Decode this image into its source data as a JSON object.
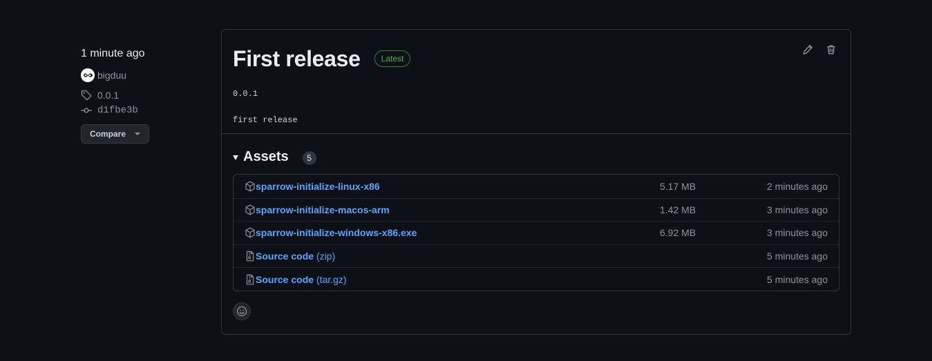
{
  "sidebar": {
    "time": "1 minute ago",
    "author": "bigduu",
    "tag": "0.0.1",
    "commit": "d1fbe3b",
    "compare_label": "Compare"
  },
  "release": {
    "title": "First release",
    "badge": "Latest",
    "tag_line": "0.0.1",
    "body": "first release"
  },
  "assets": {
    "label": "Assets",
    "count": "5",
    "items": [
      {
        "name": "sparrow-initialize-linux-x86",
        "suffix": "",
        "size": "5.17 MB",
        "when": "2 minutes ago",
        "icon": "package-icon"
      },
      {
        "name": "sparrow-initialize-macos-arm",
        "suffix": "",
        "size": "1.42 MB",
        "when": "3 minutes ago",
        "icon": "package-icon"
      },
      {
        "name": "sparrow-initialize-windows-x86.exe",
        "suffix": "",
        "size": "6.92 MB",
        "when": "3 minutes ago",
        "icon": "package-icon"
      },
      {
        "name": "Source code",
        "suffix": "(zip)",
        "size": "",
        "when": "5 minutes ago",
        "icon": "file-zip-icon"
      },
      {
        "name": "Source code",
        "suffix": "(tar.gz)",
        "size": "",
        "when": "5 minutes ago",
        "icon": "file-zip-icon"
      }
    ]
  },
  "colors": {
    "background": "#0d1117",
    "border": "#30363d",
    "link": "#58a6ff",
    "latest_green": "#3fb950",
    "muted": "#8b949e"
  }
}
